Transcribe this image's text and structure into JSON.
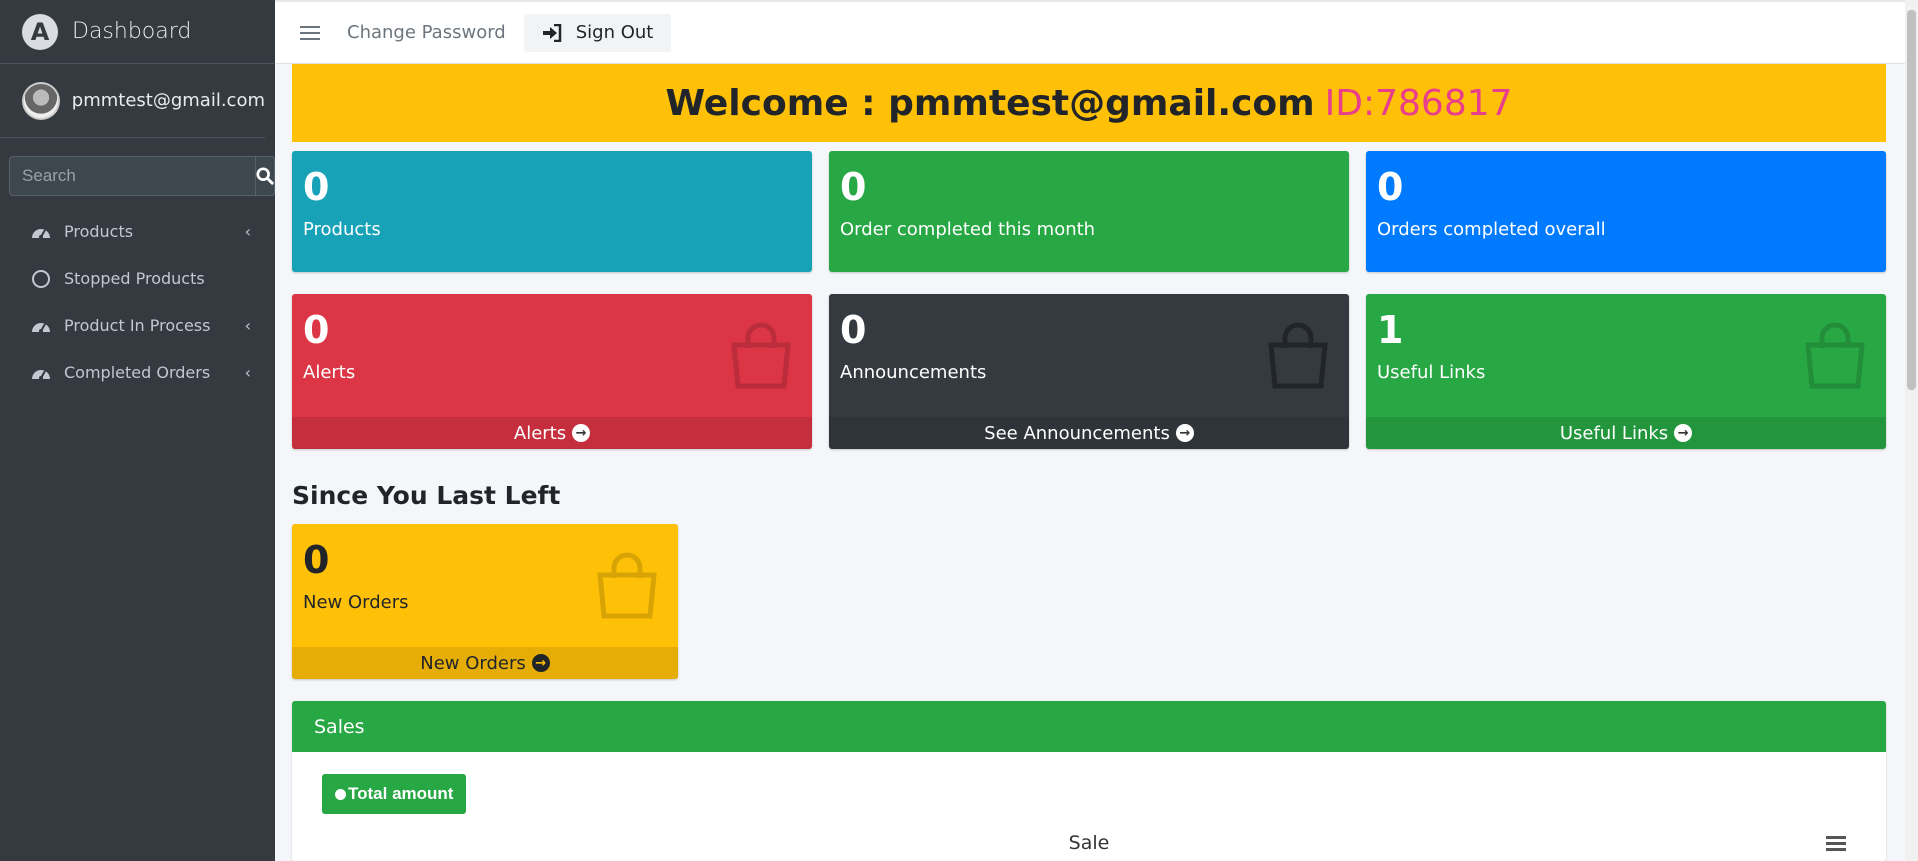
{
  "sidebar": {
    "brand": "Dashboard",
    "brand_logo": "A",
    "user_email": "pmmtest@gmail.com",
    "search_placeholder": "Search",
    "items": [
      {
        "label": "Products",
        "icon": "tachometer-icon",
        "has_chevron": true
      },
      {
        "label": "Stopped Products",
        "icon": "circle-icon",
        "has_chevron": false
      },
      {
        "label": "Product In Process",
        "icon": "tachometer-icon",
        "has_chevron": true
      },
      {
        "label": "Completed Orders",
        "icon": "tachometer-icon",
        "has_chevron": true
      }
    ],
    "chevron": "‹"
  },
  "topbar": {
    "change_password": "Change Password",
    "sign_out": "Sign Out"
  },
  "welcome": {
    "text": "Welcome : pmmtest@gmail.com",
    "id_text": "ID:786817",
    "id_color": "#e83e8c",
    "bg_color": "#ffc107"
  },
  "stats_row1": [
    {
      "value": "0",
      "label": "Products",
      "color": "#17a2b8"
    },
    {
      "value": "0",
      "label": "Order completed this month",
      "color": "#28a745"
    },
    {
      "value": "0",
      "label": "Orders completed overall",
      "color": "#007bff"
    }
  ],
  "stats_row2": [
    {
      "value": "0",
      "label": "Alerts",
      "footer": "Alerts",
      "color": "#dc3545"
    },
    {
      "value": "0",
      "label": "Announcements",
      "footer": "See Announcements",
      "color": "#343a40"
    },
    {
      "value": "1",
      "label": "Useful Links",
      "footer": "Useful Links",
      "color": "#28a745"
    }
  ],
  "since_last_left": {
    "title": "Since You Last Left",
    "value": "0",
    "label": "New Orders",
    "footer": "New Orders"
  },
  "sales": {
    "header": "Sales",
    "button": "Total amount",
    "chart_title": "Sale"
  },
  "icons": {
    "search": "search-icon",
    "hamburger": "hamburger-icon",
    "sign_out": "sign-in-icon",
    "bag": "shopping-bag-icon",
    "arrow": "arrow-circle-right-icon"
  }
}
